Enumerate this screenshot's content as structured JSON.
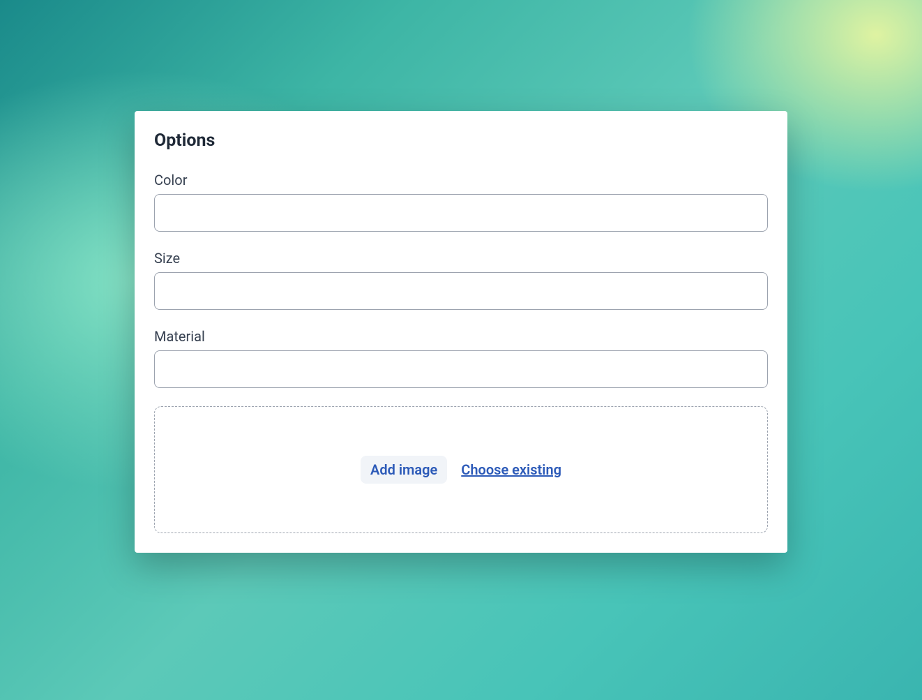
{
  "card": {
    "title": "Options"
  },
  "fields": [
    {
      "label": "Color",
      "value": ""
    },
    {
      "label": "Size",
      "value": ""
    },
    {
      "label": "Material",
      "value": ""
    }
  ],
  "dropzone": {
    "add_image_label": "Add image",
    "choose_existing_label": "Choose existing"
  }
}
